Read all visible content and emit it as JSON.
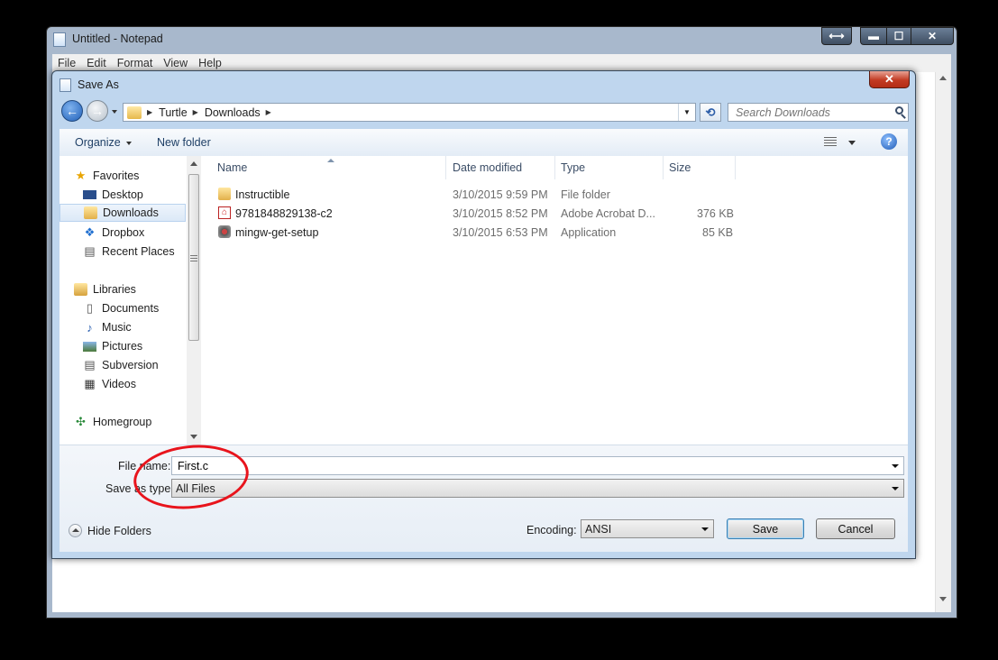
{
  "notepad": {
    "title": "Untitled - Notepad",
    "menu": [
      "File",
      "Edit",
      "Format",
      "View",
      "Help"
    ]
  },
  "dialog": {
    "title": "Save As",
    "breadcrumb": [
      "Turtle",
      "Downloads"
    ],
    "search_placeholder": "Search Downloads",
    "organize_label": "Organize",
    "new_folder_label": "New folder",
    "help_glyph": "?",
    "nav": {
      "favorites": "Favorites",
      "desktop": "Desktop",
      "downloads": "Downloads",
      "dropbox": "Dropbox",
      "recent_places": "Recent Places",
      "libraries": "Libraries",
      "documents": "Documents",
      "music": "Music",
      "pictures": "Pictures",
      "subversion": "Subversion",
      "videos": "Videos",
      "homegroup": "Homegroup"
    },
    "columns": {
      "name": "Name",
      "date_modified": "Date modified",
      "type": "Type",
      "size": "Size"
    },
    "files": [
      {
        "name": "Instructible",
        "date": "3/10/2015 9:59 PM",
        "type": "File folder",
        "size": ""
      },
      {
        "name": "9781848829138-c2",
        "date": "3/10/2015 8:52 PM",
        "type": "Adobe Acrobat D...",
        "size": "376 KB"
      },
      {
        "name": "mingw-get-setup",
        "date": "3/10/2015 6:53 PM",
        "type": "Application",
        "size": "85 KB"
      }
    ],
    "file_name_label": "File name:",
    "file_name_value": "First.c",
    "save_type_label": "Save as type:",
    "save_type_value": "All Files",
    "hide_folders_label": "Hide Folders",
    "encoding_label": "Encoding:",
    "encoding_value": "ANSI",
    "save_label": "Save",
    "cancel_label": "Cancel",
    "selected_nav": "Downloads"
  },
  "colors": {
    "annotation_circle": "#e8141c",
    "title_close": "#c23a22"
  }
}
